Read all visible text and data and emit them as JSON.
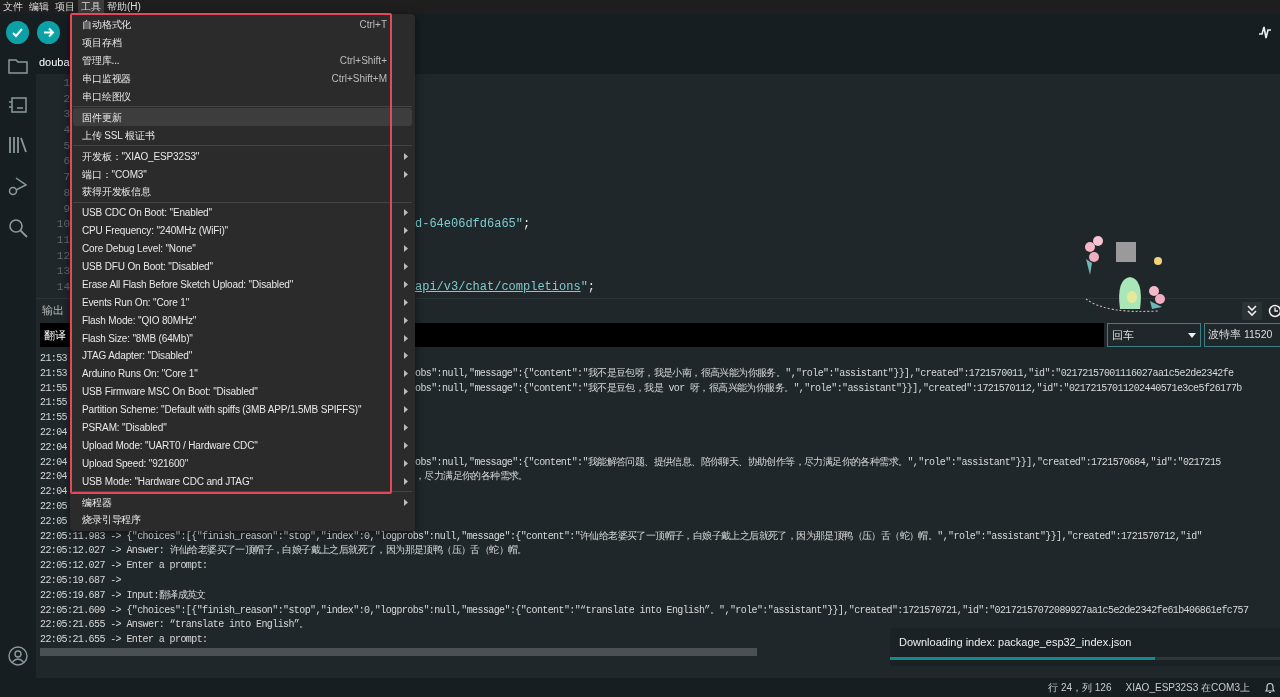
{
  "menu_bar": [
    {
      "label": "文件",
      "selected": false
    },
    {
      "label": "编辑",
      "selected": false
    },
    {
      "label": "项目",
      "selected": false
    },
    {
      "label": "工具",
      "selected": true
    },
    {
      "label": "帮助(H)",
      "selected": false
    }
  ],
  "editor": {
    "tab": "douba",
    "lines": [
      {
        "number": "1"
      },
      {
        "number": "2"
      },
      {
        "number": "3"
      },
      {
        "number": "4"
      },
      {
        "number": "5"
      },
      {
        "number": "6"
      },
      {
        "number": "7"
      },
      {
        "number": "8"
      },
      {
        "number": "9"
      },
      {
        "number": "10",
        "segments": [
          {
            "kind": "string",
            "text": "d-64e06dfd6a65\""
          },
          {
            "kind": "plain",
            "text": ";"
          }
        ]
      },
      {
        "number": "11"
      },
      {
        "number": "12"
      },
      {
        "number": "13"
      },
      {
        "number": "14",
        "segments": [
          {
            "kind": "link",
            "text": "api/v3/chat/completions"
          },
          {
            "kind": "string",
            "text": "\""
          },
          {
            "kind": "plain",
            "text": ";"
          }
        ]
      }
    ]
  },
  "output": {
    "title": "输出",
    "input_value": "翻译",
    "line_ending": "回车",
    "baud_rate": "波特率 11520",
    "lines": [
      {
        "kind": "split",
        "left": "21:53"
      },
      {
        "kind": "split",
        "left": "21:53",
        "right": "obs\":null,\"message\":{\"content\":\"我不是豆包呀，我是小南，很高兴能为你服务。\",\"role\":\"assistant\"}}],\"created\":1721570011,\"id\":\"02172157001116027aa1c5e2de2342fe"
      },
      {
        "kind": "split",
        "left": "21:55",
        "right": "obs\":null,\"message\":{\"content\":\"我不是豆包，我是 vor 呀，很高兴能为你服务。\",\"role\":\"assistant\"}}],\"created\":1721570112,\"id\":\"02172157011202440571e3ce5f26177b"
      },
      {
        "kind": "split",
        "left": "21:55"
      },
      {
        "kind": "split",
        "left": "21:55"
      },
      {
        "kind": "split",
        "left": "22:04"
      },
      {
        "kind": "split",
        "left": "22:04"
      },
      {
        "kind": "split",
        "left": "22:04",
        "right": "obs\":null,\"message\":{\"content\":\"我能解答问题、提供信息、陪你聊天、协助创作等，尽力满足你的各种需求。\",\"role\":\"assistant\"}}],\"created\":1721570684,\"id\":\"0217215"
      },
      {
        "kind": "split",
        "left": "22:04",
        "right": "，尽力满足你的各种需求。"
      },
      {
        "kind": "split",
        "left": "22:04"
      },
      {
        "kind": "split",
        "left": "22:05"
      },
      {
        "kind": "split",
        "left": "22:05"
      },
      {
        "kind": "full",
        "text": "22:05:11.983 -> {\"choices\":[{\"finish_reason\":\"stop\",\"index\":0,\"logprobs\":null,\"message\":{\"content\":\"许仙给老婆买了一顶帽子，白娘子戴上之后就死了，因为那是顶鸭（压）舌（蛇）帽。\",\"role\":\"assistant\"}}],\"created\":1721570712,\"id\""
      },
      {
        "kind": "full",
        "text": "22:05:12.027 -> Answer: 许仙给老婆买了一顶帽子，白娘子戴上之后就死了，因为那是顶鸭（压）舌（蛇）帽。"
      },
      {
        "kind": "full",
        "text": "22:05:12.027 -> Enter a prompt:"
      },
      {
        "kind": "full",
        "text": "22:05:19.687 ->"
      },
      {
        "kind": "full",
        "text": "22:05:19.687 ->  Input:翻译成英文"
      },
      {
        "kind": "full",
        "text": "22:05:21.609 -> {\"choices\":[{\"finish_reason\":\"stop\",\"index\":0,\"logprobs\":null,\"message\":{\"content\":\"“translate into English”。\",\"role\":\"assistant\"}}],\"created\":1721570721,\"id\":\"02172157072089927aa1c5e2de2342fe61b406861efc757"
      },
      {
        "kind": "full",
        "text": "22:05:21.655 -> Answer: “translate into English”。"
      },
      {
        "kind": "full",
        "text": "22:05:21.655 -> Enter a prompt:"
      }
    ]
  },
  "menu": {
    "groups": [
      [
        {
          "label": "自动格式化",
          "shortcut": "Ctrl+T",
          "submenu": false,
          "selected": false
        },
        {
          "label": "项目存档",
          "submenu": false,
          "selected": false
        },
        {
          "label": "管理库...",
          "shortcut": "Ctrl+Shift+",
          "submenu": false,
          "selected": false
        },
        {
          "label": "串口监视器",
          "shortcut": "Ctrl+Shift+M",
          "submenu": false,
          "selected": false
        },
        {
          "label": "串口绘图仪",
          "submenu": false,
          "selected": false
        }
      ],
      [
        {
          "label": "固件更新",
          "submenu": false,
          "selected": true
        },
        {
          "label": "上传 SSL 根证书",
          "submenu": false,
          "selected": false
        }
      ],
      [
        {
          "label": "开发板：\"XIAO_ESP32S3\"",
          "submenu": true,
          "selected": false
        },
        {
          "label": "端口：\"COM3\"",
          "submenu": true,
          "selected": false
        },
        {
          "label": "获得开发板信息",
          "submenu": false,
          "selected": false
        }
      ],
      [
        {
          "label": "USB CDC On Boot: \"Enabled\"",
          "submenu": true,
          "selected": false
        },
        {
          "label": "CPU Frequency: \"240MHz (WiFi)\"",
          "submenu": true,
          "selected": false
        },
        {
          "label": "Core Debug Level: \"None\"",
          "submenu": true,
          "selected": false
        },
        {
          "label": "USB DFU On Boot: \"Disabled\"",
          "submenu": true,
          "selected": false
        },
        {
          "label": "Erase All Flash Before Sketch Upload: \"Disabled\"",
          "submenu": true,
          "selected": false
        },
        {
          "label": "Events Run On: \"Core 1\"",
          "submenu": true,
          "selected": false
        },
        {
          "label": "Flash Mode: \"QIO 80MHz\"",
          "submenu": true,
          "selected": false
        },
        {
          "label": "Flash Size: \"8MB (64Mb)\"",
          "submenu": true,
          "selected": false
        },
        {
          "label": "JTAG Adapter: \"Disabled\"",
          "submenu": true,
          "selected": false
        },
        {
          "label": "Arduino Runs On: \"Core 1\"",
          "submenu": true,
          "selected": false
        },
        {
          "label": "USB Firmware MSC On Boot: \"Disabled\"",
          "submenu": true,
          "selected": false
        },
        {
          "label": "Partition Scheme: \"Default with spiffs (3MB APP/1.5MB SPIFFS)\"",
          "submenu": true,
          "selected": false
        },
        {
          "label": "PSRAM: \"Disabled\"",
          "submenu": true,
          "selected": false
        },
        {
          "label": "Upload Mode: \"UART0 / Hardware CDC\"",
          "submenu": true,
          "selected": false
        },
        {
          "label": "Upload Speed: \"921600\"",
          "submenu": true,
          "selected": false
        },
        {
          "label": "USB Mode: \"Hardware CDC and JTAG\"",
          "submenu": true,
          "selected": false
        }
      ],
      [
        {
          "label": "编程器",
          "submenu": true,
          "selected": false
        },
        {
          "label": "烧录引导程序",
          "submenu": false,
          "selected": false
        }
      ]
    ]
  },
  "notification": {
    "text": "Downloading index: package_esp32_index.json",
    "level": 0.68
  },
  "status_bar": {
    "position": "行 24，列 126",
    "board": "XIAO_ESP32S3 在COM3上"
  }
}
